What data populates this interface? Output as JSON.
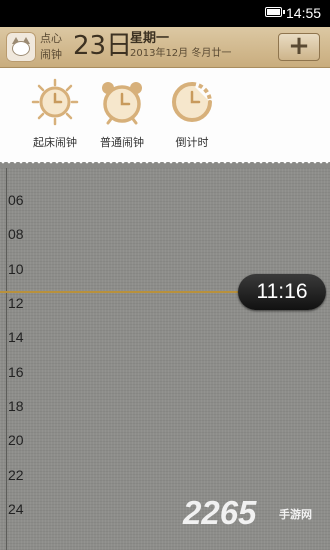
{
  "status_bar": {
    "time": "14:55",
    "battery_icon": "battery-icon"
  },
  "header": {
    "app_name": "点心闹钟",
    "day": "23日",
    "weekday": "星期一",
    "date_detail": "2013年12月 冬月廿一",
    "add_label": "+"
  },
  "shortcuts": [
    {
      "label": "起床闹钟",
      "icon": "sun-clock-icon"
    },
    {
      "label": "普通闹钟",
      "icon": "alarm-clock-icon"
    },
    {
      "label": "倒计时",
      "icon": "countdown-icon"
    }
  ],
  "timeline": {
    "hours": [
      "06",
      "08",
      "10",
      "12",
      "14",
      "16",
      "18",
      "20",
      "22",
      "24"
    ],
    "current_time": "11:16"
  },
  "watermark": {
    "number": "2265",
    "text": "手游网"
  },
  "colors": {
    "accent": "#c9ad7e",
    "now_line": "#b8913d",
    "icon_tan": "#d7b07a"
  }
}
